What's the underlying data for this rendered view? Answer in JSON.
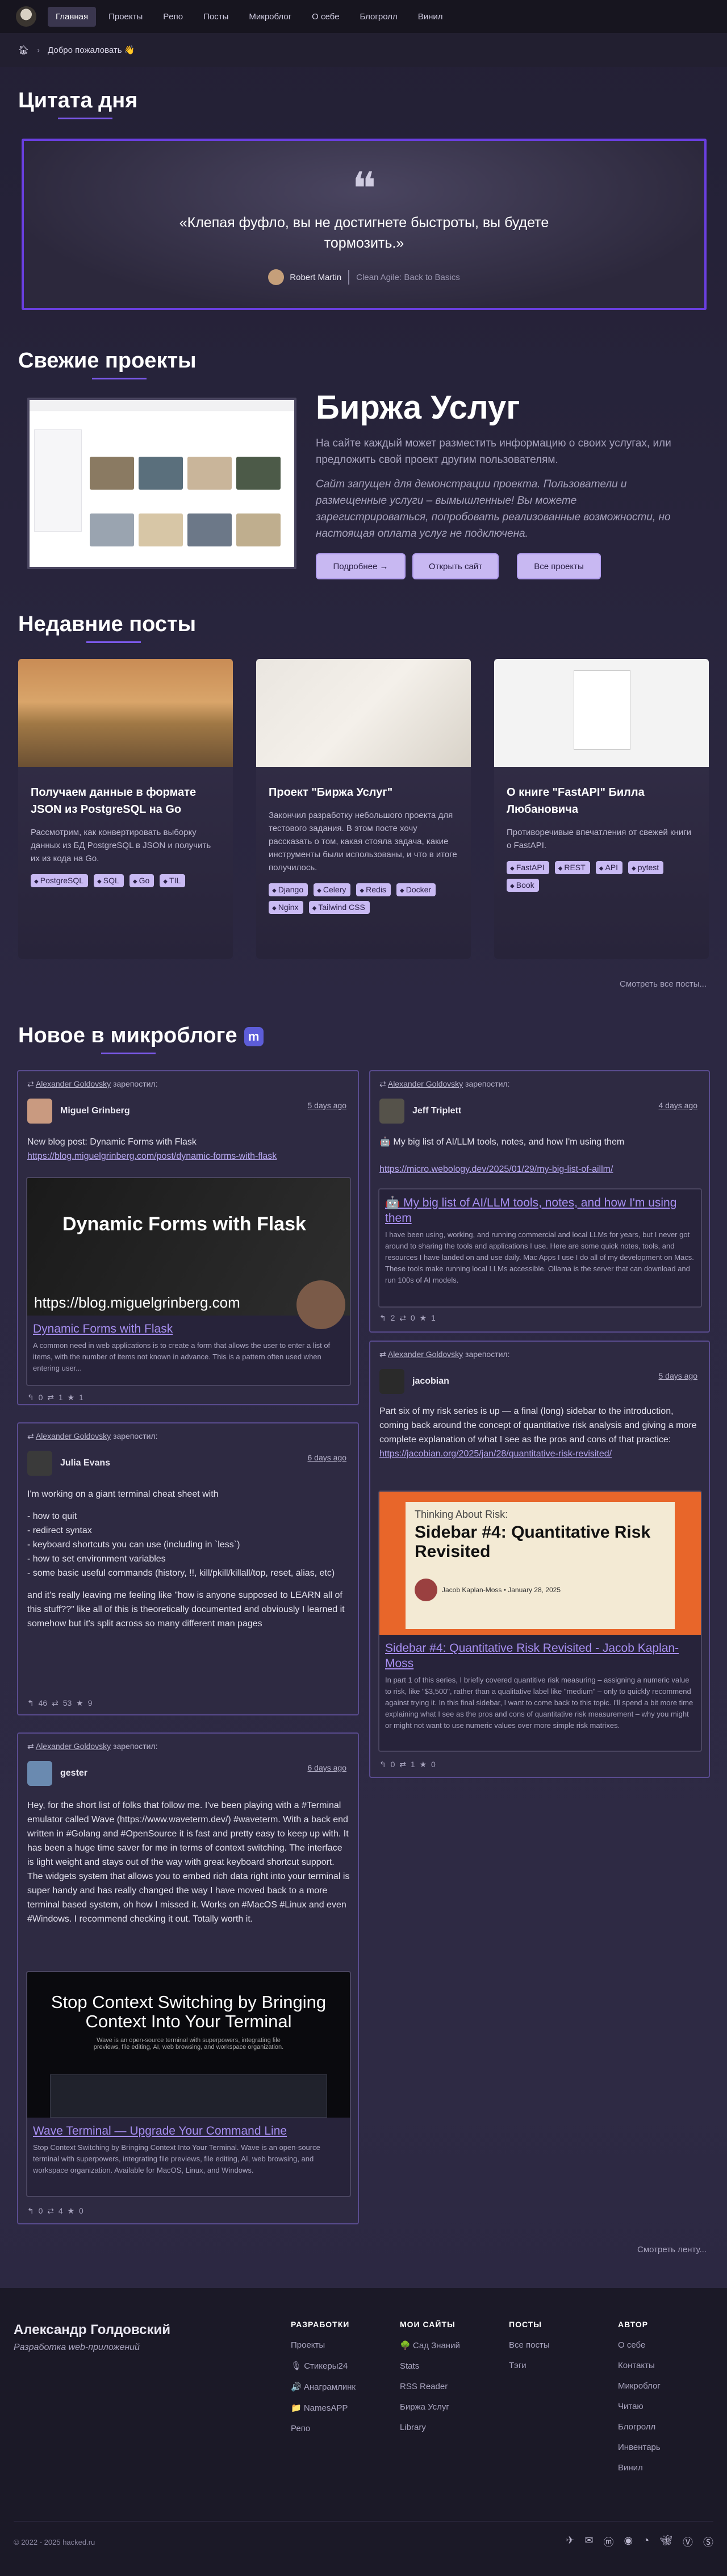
{
  "nav": {
    "items": [
      "Главная",
      "Проекты",
      "Рeпо",
      "Посты",
      "Микроблог",
      "О себе",
      "Блогролл",
      "Винил"
    ]
  },
  "breadcrumb": {
    "label": "Добро пожаловать 👋"
  },
  "quote_section": {
    "title": "Цитата дня",
    "text": "«Клепая фуфло, вы не достигнете быстроты, вы будете тормозить.»",
    "author": "Robert Martin",
    "source": "Clean Agile: Back to Basics"
  },
  "projects_section": {
    "title": "Свежие проекты",
    "project_title": "Биржа Услуг",
    "description": "На сайте каждый может разместить информацию о своих услугах, или предложить свой проект другим пользователям.",
    "note": "Сайт запущен для демонстрации проекта. Пользователи и размещенные услуги – вымышленные! Вы можете зарегистрироваться, попробовать реализованные возможности, но настоящая оплата услуг не подключена.",
    "buttons": {
      "more": "Подробнее →",
      "open": "Открыть сайт",
      "all": "Все проекты"
    }
  },
  "posts_section": {
    "title": "Недавние посты",
    "posts": [
      {
        "title": "Получаем данные в формате JSON из PostgreSQL на Go",
        "desc": "Рассмотрим, как конвертировать выборку данных из БД PostgreSQL в JSON и получить их из кода на Go.",
        "tags": [
          "PostgreSQL",
          "SQL",
          "Go",
          "TIL"
        ]
      },
      {
        "title": "Проект \"Биржа Услуг\"",
        "desc": "Закончил разработку небольшого проекта для тестового задания. В этом посте хочу рассказать о том, какая стояла задача, какие инструменты были использованы, и что в итоге получилось.",
        "tags": [
          "Django",
          "Celery",
          "Redis",
          "Docker",
          "Nginx",
          "Tailwind CSS"
        ]
      },
      {
        "title": "О книге \"FastAPI\" Билла Любановича",
        "desc": "Противоречивые впечатления от свежей книги о FastAPI.",
        "tags": [
          "FastAPI",
          "REST",
          "API",
          "pytest",
          "Book"
        ]
      }
    ],
    "more": "Смотреть все посты..."
  },
  "micro_section": {
    "title": "Новое в микроблоге",
    "reposter": "Alexander Goldovsky",
    "reposted": "зарепостил:",
    "posts": [
      {
        "author": "Miguel Grinberg",
        "date": "5 days ago",
        "text": "New blog post: Dynamic Forms with Flask ",
        "link": "https://blog.miguelgrinberg.com/post/dynamic-forms-with-flask",
        "preview_image_title": "Dynamic Forms with Flask",
        "preview_image_url": "https://blog.miguelgrinberg.com",
        "preview_title": "Dynamic Forms with Flask",
        "preview_desc": "A common need in web applications is to create a form that allows the user to enter a list of items, with the number of items not known in advance. This is a pattern often used when entering user...",
        "stats": "↰ 0 ⇄ 1 ★ 1"
      },
      {
        "author": "Julia Evans",
        "date": "6 days ago",
        "lines": [
          "I'm working on a giant terminal cheat sheet with",
          "",
          "- how to quit",
          "- redirect syntax",
          "- keyboard shortcuts you can use (including in `less`)",
          "- how to set environment variables",
          "- some basic useful commands (history, !!, kill/pkill/killall/top, reset, alias, etc)",
          "",
          "and it's really leaving me feeling like \"how is anyone supposed to LEARN all of this stuff??\" like all of this is theoretically documented and obviously I learned it somehow but it's split across so many different man pages"
        ],
        "stats": "↰ 46 ⇄ 53 ★ 9"
      },
      {
        "author": "gester",
        "date": "6 days ago",
        "text": "Hey, for the short list of folks that follow me. I've been playing with a #Terminal emulator called Wave (https://www.waveterm.dev/) #waveterm. With a back end written in #Golang and #OpenSource it is fast and pretty easy to keep up with. It has been a huge time saver for me in terms of context switching. The interface is light weight and stays out of the way with great keyboard shortcut support. The widgets system that allows you to embed rich data right into your terminal is super handy and has really changed the way I have moved back to a more terminal based system, oh how I missed it. Works on #MacOS #Linux and even #Windows. I recommend checking it out. Totally worth it.",
        "preview_image_title": "Stop Context Switching by Bringing Context Into Your Terminal",
        "preview_image_sub": "Wave is an open-source terminal with superpowers, integrating file previews, file editing, AI, web browsing, and workspace organization.",
        "preview_title": "Wave Terminal — Upgrade Your Command Line",
        "preview_desc": "Stop Context Switching by Bringing Context Into Your Terminal. Wave is an open-source terminal with superpowers, integrating file previews, file editing, AI, web browsing, and workspace organization. Available for MacOS, Linux, and Windows.",
        "stats": "↰ 0 ⇄ 4 ★ 0"
      },
      {
        "author": "Jeff Triplett",
        "date": "4 days ago",
        "text": "🤖 My big list of AI/LLM tools, notes, and how I'm using them",
        "link": "https://micro.webology.dev/2025/01/29/my-big-list-of-aillm/",
        "preview_title": "🤖 My big list of AI/LLM tools, notes, and how I'm using them",
        "preview_desc": "I have been using, working, and running commercial and local LLMs for years, but I never got around to sharing the tools and applications I use. Here are some quick notes, tools, and resources I have landed on and use daily. Mac Apps I use I do all of my development on Macs. These tools make running local LLMs accessible. Ollama is the server that can download and run 100s of AI models.",
        "stats": "↰ 2 ⇄ 0 ★ 1"
      },
      {
        "author": "jacobian",
        "date": "5 days ago",
        "text": "Part six of my risk series is up — a final (long) sidebar to the introduction, coming back around the concept of quantitative risk analysis and giving a more complete explanation of what I see as the pros and cons of that practice: ",
        "link": "https://jacobian.org/2025/jan/28/quantitative-risk-revisited/",
        "preview_image_kicker": "Thinking About Risk:",
        "preview_image_title": "Sidebar #4: Quantitative Risk Revisited",
        "preview_image_meta": "Jacob Kaplan-Moss • January 28, 2025",
        "preview_title": "Sidebar #4: Quantitative Risk Revisited - Jacob Kaplan-Moss",
        "preview_desc": "In part 1 of this series, I briefly covered quantitive risk measuring – assigning a numeric value to risk, like \"$3,500\", rather than a qualitative label like \"medium\" – only to quickly recommend against trying it. In this final sidebar, I want to come back to this topic. I'll spend a bit more time explaining what I see as the pros and cons of quantitative risk measurement – why you might or might not want to use numeric values over more simple risk matrixes.",
        "stats": "↰ 0 ⇄ 1 ★ 0"
      }
    ],
    "more": "Смотреть ленту..."
  },
  "footer": {
    "name": "Александр Голдовский",
    "subtitle": "Разработка web-приложений",
    "cols": [
      {
        "title": "РАЗРАБОТКИ",
        "items": [
          "Проекты",
          "🎙 Стикеры24",
          "🔊 Анаграмлинк",
          "📁 NamesAPP",
          "Репо"
        ]
      },
      {
        "title": "МОИ САЙТЫ",
        "items": [
          "🌳 Сад Знаний",
          "Stats",
          "RSS Reader",
          "Биржа Услуг",
          "Library"
        ]
      },
      {
        "title": "ПОСТЫ",
        "items": [
          "Все посты",
          "Тэги"
        ]
      },
      {
        "title": "АВТОР",
        "items": [
          "О себе",
          "Контакты",
          "Микроблог",
          "Читаю",
          "Блогролл",
          "Инвентарь",
          "Винил"
        ]
      }
    ],
    "copyright": "© 2022 - 2025 hacked.ru",
    "social_icons": [
      "telegram-icon",
      "mail-icon",
      "mastodon-icon",
      "github-icon",
      "rss-icon",
      "bluesky-icon",
      "vk-icon",
      "strava-icon"
    ]
  }
}
